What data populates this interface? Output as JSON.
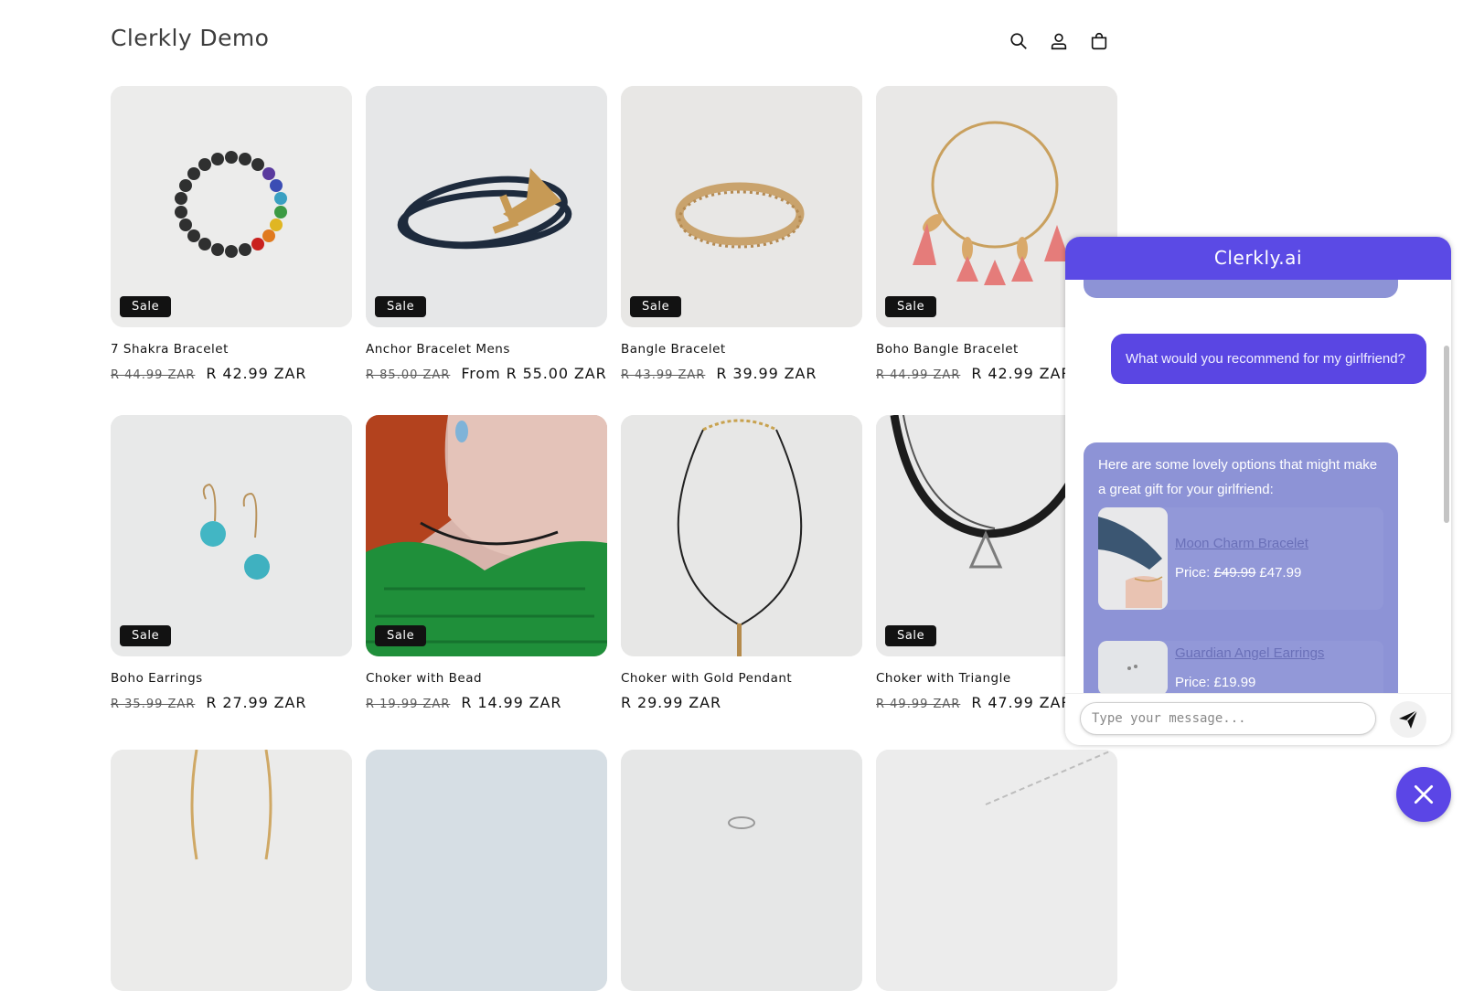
{
  "header": {
    "store_name": "Clerkly Demo",
    "icons": [
      "search-icon",
      "account-icon",
      "cart-icon"
    ]
  },
  "products": [
    {
      "name": "7 Shakra Bracelet",
      "old_price": "R 44.99 ZAR",
      "price": "R 42.99 ZAR",
      "badge": "Sale"
    },
    {
      "name": "Anchor Bracelet Mens",
      "old_price": "R 85.00 ZAR",
      "price": "From R 55.00 ZAR",
      "badge": "Sale"
    },
    {
      "name": "Bangle Bracelet",
      "old_price": "R 43.99 ZAR",
      "price": "R 39.99 ZAR",
      "badge": "Sale"
    },
    {
      "name": "Boho Bangle Bracelet",
      "old_price": "R 44.99 ZAR",
      "price": "R 42.99 ZAR",
      "badge": "Sale"
    },
    {
      "name": "Boho Earrings",
      "old_price": "R 35.99 ZAR",
      "price": "R 27.99 ZAR",
      "badge": "Sale"
    },
    {
      "name": "Choker with Bead",
      "old_price": "R 19.99 ZAR",
      "price": "R 14.99 ZAR",
      "badge": "Sale"
    },
    {
      "name": "Choker with Gold Pendant",
      "old_price": "",
      "price": "R 29.99 ZAR",
      "badge": ""
    },
    {
      "name": "Choker with Triangle",
      "old_price": "R 49.99 ZAR",
      "price": "R 47.99 ZAR",
      "badge": "Sale"
    }
  ],
  "chat": {
    "title": "Clerkly.ai",
    "user_message": "What would you recommend for my girlfriend?",
    "bot_message": "Here are some lovely options that might make a great gift for your girlfriend:",
    "recommendations": [
      {
        "name": "Moon Charm Bracelet",
        "price_label": "Price:",
        "old_price": "£49.99",
        "price": "£47.99"
      },
      {
        "name": "Guardian Angel Earrings",
        "price_label": "Price:",
        "old_price": "",
        "price": "£19.99"
      }
    ],
    "input_placeholder": "Type your message...",
    "colors": {
      "header": "#5b4ae5",
      "user_bubble": "#5a46e3",
      "bot_bubble": "#8d93d6"
    }
  }
}
